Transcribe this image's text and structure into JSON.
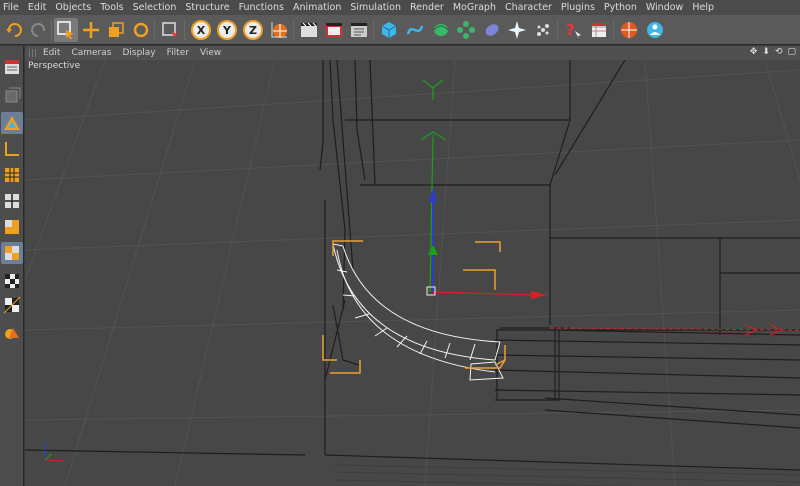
{
  "menu": {
    "items": [
      "File",
      "Edit",
      "Objects",
      "Tools",
      "Selection",
      "Structure",
      "Functions",
      "Animation",
      "Simulation",
      "Render",
      "MoGraph",
      "Character",
      "Plugins",
      "Python",
      "Window",
      "Help"
    ]
  },
  "toolbar": {
    "buttons": [
      "undo-icon",
      "redo-icon",
      "live-selection-icon",
      "move-icon",
      "scale-icon",
      "rotate-icon",
      "recent-tool-icon",
      "x-axis-icon",
      "y-axis-icon",
      "z-axis-icon",
      "coordinate-system-icon",
      "render-view-icon",
      "render-picture-viewer-icon",
      "render-settings-icon",
      "cube-icon",
      "spline-pen-icon",
      "nurbs-icon",
      "array-icon",
      "deformer-icon",
      "scene-icon",
      "particles-icon",
      "camera-icon",
      "help-icon",
      "null-icon",
      "mograph-icon",
      "character-icon"
    ],
    "axis_labels": {
      "x": "X",
      "y": "Y",
      "z": "Z"
    }
  },
  "left_tools": [
    "model-mode-icon",
    "object-mode-icon",
    "texture-mode-icon",
    "axis-mode-icon",
    "points-mode-icon",
    "edges-mode-icon",
    "polygons-mode-icon",
    "uvw-mode-icon",
    "snap-icon",
    "checker-icon",
    "workplane-icon",
    "soft-selection-icon"
  ],
  "viewport": {
    "menu": [
      "Edit",
      "Cameras",
      "Display",
      "Filter",
      "View"
    ],
    "nav_icons": [
      "✥",
      "⬇",
      "⟲",
      "▢"
    ],
    "label": "Perspective"
  },
  "colors": {
    "menubar": "#4b4b4b",
    "toolbar": "#5a5a5a",
    "viewport_bg": "#474747",
    "grid": "#535353",
    "wire": "#1e1e1e",
    "selection": "#e8a033",
    "axis_x": "#d82222",
    "axis_y": "#1aa01a",
    "axis_z": "#2a3ccc",
    "tool_accent": "#f0a020"
  }
}
